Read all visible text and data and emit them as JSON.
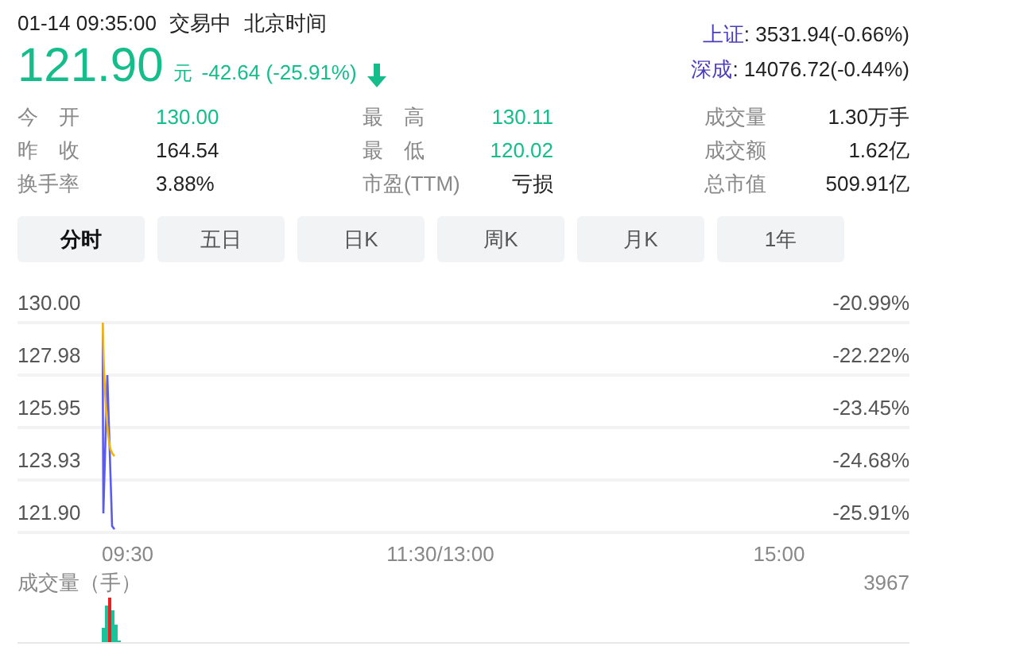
{
  "header": {
    "datetime": "01-14 09:35:00",
    "trade_status": "交易中",
    "timezone": "北京时间",
    "price": "121.90",
    "unit": "元",
    "change": "-42.64 (-25.91%)"
  },
  "indices": [
    {
      "name": "上证",
      "value": ": 3531.94(-0.66%)"
    },
    {
      "name": "深成",
      "value": ": 14076.72(-0.44%)"
    }
  ],
  "stats": [
    {
      "label": "今　开",
      "value": "130.00",
      "color": "#15bd8b"
    },
    {
      "label": "最　高",
      "value": "130.11",
      "color": "#15bd8b"
    },
    {
      "label": "成交量",
      "value": "1.30万手",
      "color": "#222222"
    },
    {
      "label": "昨　收",
      "value": "164.54",
      "color": "#222222"
    },
    {
      "label": "最　低",
      "value": "120.02",
      "color": "#15bd8b"
    },
    {
      "label": "成交额",
      "value": "1.62亿",
      "color": "#222222"
    },
    {
      "label": "换手率",
      "value": "3.88%",
      "color": "#222222"
    },
    {
      "label": "市盈(TTM)",
      "value": "亏损",
      "color": "#222222"
    },
    {
      "label": "总市值",
      "value": "509.91亿",
      "color": "#222222"
    }
  ],
  "tabs": [
    {
      "label": "分时",
      "selected": true
    },
    {
      "label": "五日",
      "selected": false
    },
    {
      "label": "日K",
      "selected": false
    },
    {
      "label": "周K",
      "selected": false
    },
    {
      "label": "月K",
      "selected": false
    },
    {
      "label": "1年",
      "selected": false
    }
  ],
  "price_chart": {
    "left_labels": [
      "130.00",
      "127.98",
      "125.95",
      "123.93",
      "121.90"
    ],
    "right_labels": [
      "-20.99%",
      "-22.22%",
      "-23.45%",
      "-24.68%",
      "-25.91%"
    ],
    "time_labels": [
      "09:30",
      "11:30/13:00",
      "15:00"
    ]
  },
  "volume_chart": {
    "title": "成交量（手）",
    "max_label": "3967"
  }
}
